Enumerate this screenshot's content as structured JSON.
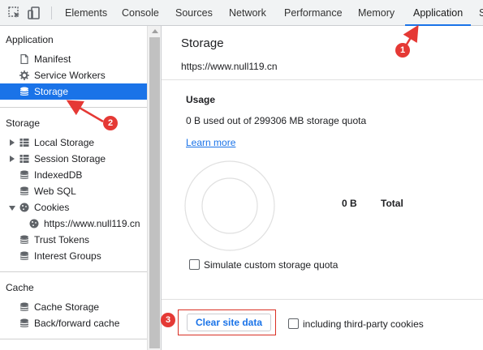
{
  "toolbar": {
    "icons": [
      "inspect-element-icon",
      "device-toolbar-icon"
    ],
    "tabs": [
      "Elements",
      "Console",
      "Sources",
      "Network",
      "Performance",
      "Memory",
      "Application"
    ],
    "active_tab": "Application",
    "overflow_tab": "S"
  },
  "sidebar": {
    "application": {
      "title": "Application",
      "items": [
        "Manifest",
        "Service Workers",
        "Storage"
      ],
      "selected": "Storage"
    },
    "storage": {
      "title": "Storage",
      "items": [
        "Local Storage",
        "Session Storage",
        "IndexedDB",
        "Web SQL",
        "Cookies"
      ],
      "cookie_origin": "https://www.null119.cn",
      "extra_items": [
        "Trust Tokens",
        "Interest Groups"
      ]
    },
    "cache": {
      "title": "Cache",
      "items": [
        "Cache Storage",
        "Back/forward cache"
      ]
    }
  },
  "main": {
    "title": "Storage",
    "origin": "https://www.null119.cn",
    "usage_heading": "Usage",
    "usage_text": "0 B used out of 299306 MB storage quota",
    "learn_more": "Learn more",
    "total_value": "0 B",
    "total_label": "Total",
    "simulate_label": "Simulate custom storage quota",
    "simulate_checked": false,
    "clear_button": "Clear site data",
    "third_party_label": "including third-party cookies",
    "third_party_checked": false
  },
  "annotations": [
    "1",
    "2",
    "3"
  ],
  "colors": {
    "accent": "#1a73e8",
    "annotation": "#e53935",
    "selected_bg": "#1a73e8"
  }
}
